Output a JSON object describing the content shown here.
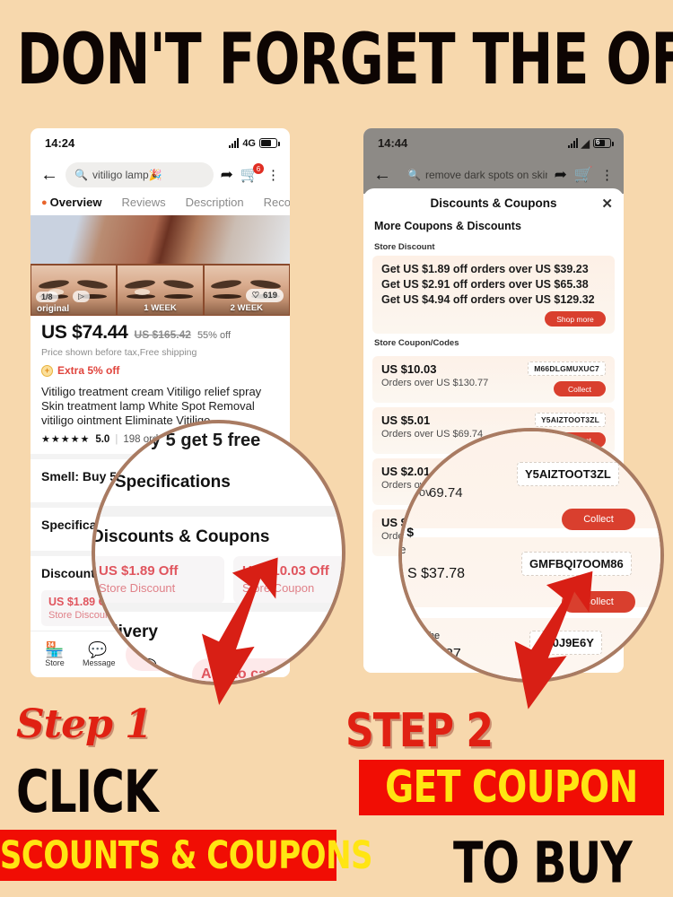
{
  "headline": "DON'T FORGET THE OFFERS",
  "background_color": "#f7d8ad",
  "accent_red": "#e02113",
  "banner_yellow": "#ffe512",
  "left_phone": {
    "status": {
      "time": "14:24",
      "network": "4G",
      "battery_level": ""
    },
    "nav": {
      "back_icon": "back-arrow-icon",
      "search_value": "vitiligo lamp🎉",
      "share_icon": "share-icon",
      "cart_icon": "cart-icon",
      "cart_badge": "6",
      "more_icon": "more-dots-icon"
    },
    "tabs": [
      {
        "label": "Overview",
        "active": true
      },
      {
        "label": "Reviews",
        "active": false
      },
      {
        "label": "Description",
        "active": false
      },
      {
        "label": "Reco",
        "active": false
      }
    ],
    "gallery": {
      "counter": "1/8",
      "play_icon": "play-icon",
      "original_label": "original",
      "thumb2_label": "1 WEEK",
      "thumb3_label": "2 WEEK",
      "likes": "619"
    },
    "product": {
      "price": "US $74.44",
      "old_price": "US $165.42",
      "discount_pct": "55% off",
      "tax_note": "Price shown before tax,Free shipping",
      "extra_badge": "Extra 5% off",
      "title": "Vitiligo treatment cream  Vitiligo relief spray  Skin treatment lamp White Spot Removal vitiligo ointment Eliminate Vitiligo",
      "stars": "★★★★★",
      "rating": "5.0",
      "orders": "198 orders",
      "promo": "Smell: Buy 5 get 5 free",
      "specifications_label": "Specifications",
      "discounts_label": "Discounts & Coupons",
      "delivery_label": "Delivery",
      "chips": [
        {
          "amount": "US $1.89 Off",
          "label": "Store Discount"
        },
        {
          "amount": "US $10.03 Off",
          "label": "Store Coupon"
        }
      ]
    },
    "bottom_bar": {
      "store_label": "Store",
      "store_icon": "store-icon",
      "message_label": "Message",
      "message_icon": "message-icon",
      "add_to_cart": "Add to cart"
    }
  },
  "right_phone": {
    "status": {
      "time": "14:44",
      "wifi_icon": "wifi-icon",
      "battery_level": "6"
    },
    "nav": {
      "back_icon": "back-arrow-icon",
      "search_value": "remove dark spots on skin",
      "share_icon": "share-icon",
      "cart_icon": "cart-icon",
      "more_icon": "more-dots-icon"
    },
    "modal": {
      "title": "Discounts & Coupons",
      "close_icon": "close-icon",
      "subtitle": "More Coupons & Discounts",
      "store_discount_label": "Store Discount",
      "store_discount_lines": [
        "Get US $1.89 off orders over US $39.23",
        "Get US $2.91 off orders over US $65.38",
        "Get US $4.94 off orders over US $129.32"
      ],
      "shop_more": "Shop more",
      "store_coupon_label": "Store Coupon/Codes",
      "coupons": [
        {
          "amount": "US $10.03",
          "condition": "Orders over US $130.77",
          "code": "M66DLGMUXUC7",
          "action": "Collect"
        },
        {
          "amount": "US $5.01",
          "condition": "Orders over US $69.74",
          "code": "Y5AIZTOOT3ZL",
          "action": "Collect"
        },
        {
          "amount": "US $2.01",
          "condition": "Orders over US $69.74",
          "code": "GMFBQI7OOM86",
          "action": "Collect"
        },
        {
          "amount": "US $37.78",
          "condition": "Orders over",
          "code": "5K0J9E6Y",
          "action": "Collect"
        }
      ]
    }
  },
  "magnifier_left": {
    "free_text": "y 5 get 5 free",
    "specifications": "Specifications",
    "discounts_title": "Discounts & Coupons",
    "chip1_amount": "US $1.89 Off",
    "chip1_label": "Store Discount",
    "chip2_amount": "US $10.03 Off",
    "chip2_label": "Store Coupon",
    "delivery": "Delivery",
    "message_label": "essage",
    "add_to_cart": "Add to cart"
  },
  "magnifier_right": {
    "code1": "Y5AIZTOOT3ZL",
    "collect1": "Collect",
    "code2": "GMFBQI7OOM86",
    "collect2": "Collect",
    "code3": "5K0J9E6Y",
    "amount_201": "$2.01",
    "cond_201": "ders ov",
    "num_6974": "69.74",
    "amount_us": "S $",
    "orders_txt": "de",
    "amount_3778": "S $37.78",
    "checkout_txt": "Che",
    "num_27": "27"
  },
  "steps": {
    "step1_label": "Step 1",
    "step1_action": "CLICK",
    "step1_banner": "DISCOUNTS & COUPONS",
    "step2_label": "STEP 2",
    "step2_banner": "GET COUPON",
    "step2_action": "TO BUY"
  }
}
